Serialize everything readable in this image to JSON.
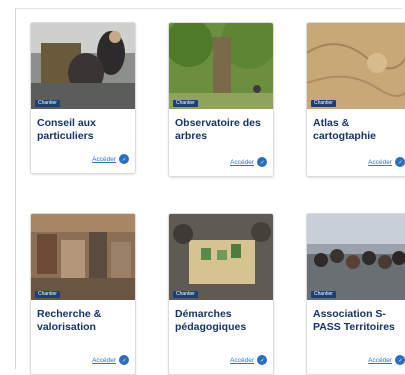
{
  "cards": [
    {
      "badge": "Chantier",
      "title": "Conseil aux particuliers",
      "link": "Accéder"
    },
    {
      "badge": "Chantier",
      "title": "Observatoire des arbres",
      "link": "Accéder"
    },
    {
      "badge": "Chantier",
      "title": "Atlas & cartogtaphie",
      "link": "Accéder"
    },
    {
      "badge": "Chantier",
      "title": "Recherche & valorisation",
      "link": "Accéder"
    },
    {
      "badge": "Chantier",
      "title": "Démarches pédagogiques",
      "link": "Accéder"
    },
    {
      "badge": "Chantier",
      "title": "Association S-PASS Territoires",
      "link": "Accéder"
    }
  ],
  "icons": {
    "link_icon": "compass-arrow-icon"
  },
  "colors": {
    "badge": "#1c3f75",
    "title": "#17336b",
    "link": "#2a76c9"
  }
}
